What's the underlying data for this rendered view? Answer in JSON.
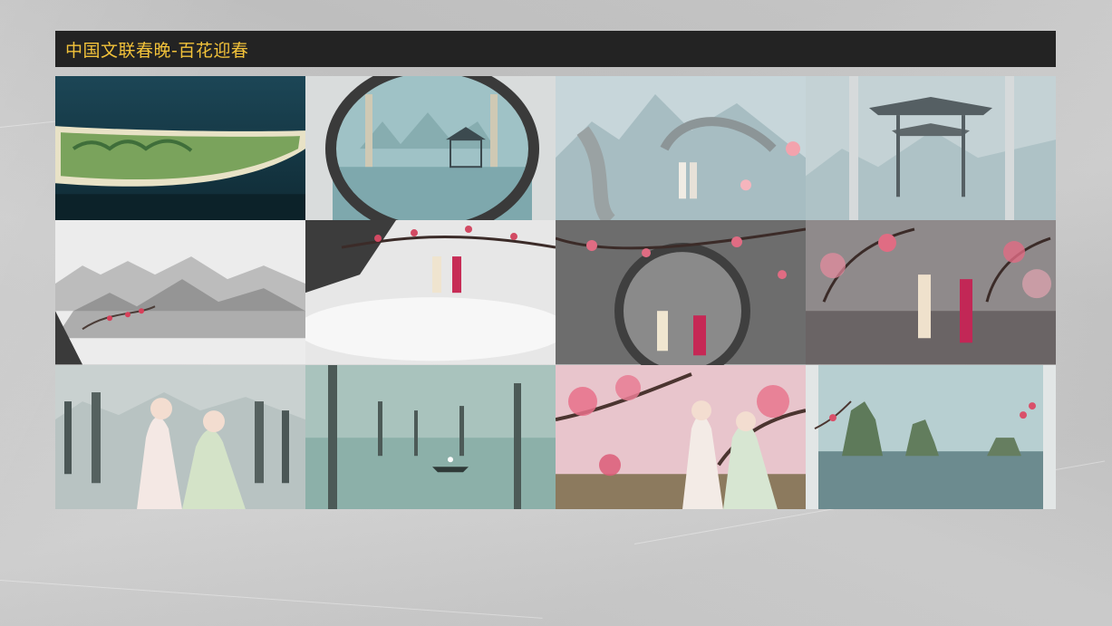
{
  "page": {
    "title": "中国文联春晚-百花迎春"
  },
  "colors": {
    "title_bar_bg": "#232323",
    "title_text": "#f2c23a",
    "background": "#cfcfcf"
  },
  "gallery": {
    "tiles": [
      {
        "id": "tile-1",
        "scene": "scroll-painting-over-water"
      },
      {
        "id": "tile-2",
        "scene": "moon-gate-pavilion"
      },
      {
        "id": "tile-3",
        "scene": "misty-ribbons-performers"
      },
      {
        "id": "tile-4",
        "scene": "gate-pavilion-mist"
      },
      {
        "id": "tile-5",
        "scene": "ink-mountains-plum"
      },
      {
        "id": "tile-6",
        "scene": "plum-branches-clouds-performers"
      },
      {
        "id": "tile-7",
        "scene": "ink-circle-plum-performers"
      },
      {
        "id": "tile-8",
        "scene": "plum-grove-performers"
      },
      {
        "id": "tile-9",
        "scene": "two-actresses-calligraphy"
      },
      {
        "id": "tile-10",
        "scene": "calligraphy-strokes-boat"
      },
      {
        "id": "tile-11",
        "scene": "plum-blossom-actresses"
      },
      {
        "id": "tile-12",
        "scene": "rock-islands-plum"
      }
    ]
  }
}
